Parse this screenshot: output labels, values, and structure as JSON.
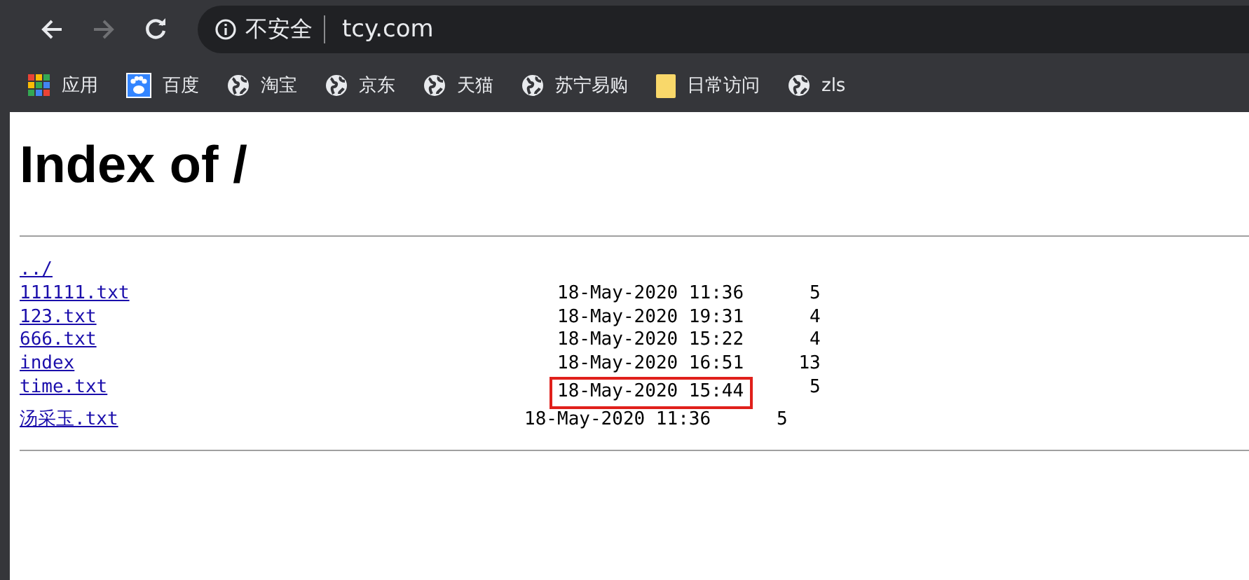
{
  "toolbar": {
    "security_label": "不安全",
    "url": "tcy.com"
  },
  "bookmarks": [
    {
      "kind": "apps",
      "label": "应用"
    },
    {
      "kind": "paw",
      "label": "百度"
    },
    {
      "kind": "globe",
      "label": "淘宝"
    },
    {
      "kind": "globe",
      "label": "京东"
    },
    {
      "kind": "globe",
      "label": "天猫"
    },
    {
      "kind": "globe",
      "label": "苏宁易购"
    },
    {
      "kind": "folder",
      "label": "日常访问"
    },
    {
      "kind": "globe",
      "label": "zls"
    }
  ],
  "page": {
    "title": "Index of /",
    "parent_link": "../",
    "files": [
      {
        "name": "111111.txt",
        "date": "18-May-2020 11:36",
        "size": "5",
        "highlighted": false
      },
      {
        "name": "123.txt",
        "date": "18-May-2020 19:31",
        "size": "4",
        "highlighted": false
      },
      {
        "name": "666.txt",
        "date": "18-May-2020 15:22",
        "size": "4",
        "highlighted": false
      },
      {
        "name": "index",
        "date": "18-May-2020 16:51",
        "size": "13",
        "highlighted": false
      },
      {
        "name": "time.txt",
        "date": "18-May-2020 15:44",
        "size": "5",
        "highlighted": true
      },
      {
        "name": "汤采玉.txt",
        "date": "18-May-2020 11:36",
        "size": "5",
        "highlighted": false
      }
    ]
  }
}
